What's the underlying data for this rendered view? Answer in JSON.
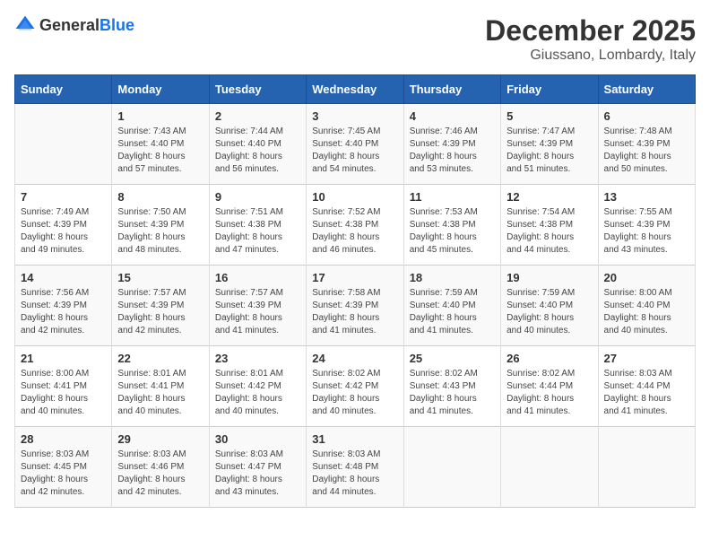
{
  "header": {
    "logo_general": "General",
    "logo_blue": "Blue",
    "month": "December 2025",
    "location": "Giussano, Lombardy, Italy"
  },
  "days_of_week": [
    "Sunday",
    "Monday",
    "Tuesday",
    "Wednesday",
    "Thursday",
    "Friday",
    "Saturday"
  ],
  "weeks": [
    [
      {
        "day": "",
        "info": ""
      },
      {
        "day": "1",
        "info": "Sunrise: 7:43 AM\nSunset: 4:40 PM\nDaylight: 8 hours\nand 57 minutes."
      },
      {
        "day": "2",
        "info": "Sunrise: 7:44 AM\nSunset: 4:40 PM\nDaylight: 8 hours\nand 56 minutes."
      },
      {
        "day": "3",
        "info": "Sunrise: 7:45 AM\nSunset: 4:40 PM\nDaylight: 8 hours\nand 54 minutes."
      },
      {
        "day": "4",
        "info": "Sunrise: 7:46 AM\nSunset: 4:39 PM\nDaylight: 8 hours\nand 53 minutes."
      },
      {
        "day": "5",
        "info": "Sunrise: 7:47 AM\nSunset: 4:39 PM\nDaylight: 8 hours\nand 51 minutes."
      },
      {
        "day": "6",
        "info": "Sunrise: 7:48 AM\nSunset: 4:39 PM\nDaylight: 8 hours\nand 50 minutes."
      }
    ],
    [
      {
        "day": "7",
        "info": "Sunrise: 7:49 AM\nSunset: 4:39 PM\nDaylight: 8 hours\nand 49 minutes."
      },
      {
        "day": "8",
        "info": "Sunrise: 7:50 AM\nSunset: 4:39 PM\nDaylight: 8 hours\nand 48 minutes."
      },
      {
        "day": "9",
        "info": "Sunrise: 7:51 AM\nSunset: 4:38 PM\nDaylight: 8 hours\nand 47 minutes."
      },
      {
        "day": "10",
        "info": "Sunrise: 7:52 AM\nSunset: 4:38 PM\nDaylight: 8 hours\nand 46 minutes."
      },
      {
        "day": "11",
        "info": "Sunrise: 7:53 AM\nSunset: 4:38 PM\nDaylight: 8 hours\nand 45 minutes."
      },
      {
        "day": "12",
        "info": "Sunrise: 7:54 AM\nSunset: 4:38 PM\nDaylight: 8 hours\nand 44 minutes."
      },
      {
        "day": "13",
        "info": "Sunrise: 7:55 AM\nSunset: 4:39 PM\nDaylight: 8 hours\nand 43 minutes."
      }
    ],
    [
      {
        "day": "14",
        "info": "Sunrise: 7:56 AM\nSunset: 4:39 PM\nDaylight: 8 hours\nand 42 minutes."
      },
      {
        "day": "15",
        "info": "Sunrise: 7:57 AM\nSunset: 4:39 PM\nDaylight: 8 hours\nand 42 minutes."
      },
      {
        "day": "16",
        "info": "Sunrise: 7:57 AM\nSunset: 4:39 PM\nDaylight: 8 hours\nand 41 minutes."
      },
      {
        "day": "17",
        "info": "Sunrise: 7:58 AM\nSunset: 4:39 PM\nDaylight: 8 hours\nand 41 minutes."
      },
      {
        "day": "18",
        "info": "Sunrise: 7:59 AM\nSunset: 4:40 PM\nDaylight: 8 hours\nand 41 minutes."
      },
      {
        "day": "19",
        "info": "Sunrise: 7:59 AM\nSunset: 4:40 PM\nDaylight: 8 hours\nand 40 minutes."
      },
      {
        "day": "20",
        "info": "Sunrise: 8:00 AM\nSunset: 4:40 PM\nDaylight: 8 hours\nand 40 minutes."
      }
    ],
    [
      {
        "day": "21",
        "info": "Sunrise: 8:00 AM\nSunset: 4:41 PM\nDaylight: 8 hours\nand 40 minutes."
      },
      {
        "day": "22",
        "info": "Sunrise: 8:01 AM\nSunset: 4:41 PM\nDaylight: 8 hours\nand 40 minutes."
      },
      {
        "day": "23",
        "info": "Sunrise: 8:01 AM\nSunset: 4:42 PM\nDaylight: 8 hours\nand 40 minutes."
      },
      {
        "day": "24",
        "info": "Sunrise: 8:02 AM\nSunset: 4:42 PM\nDaylight: 8 hours\nand 40 minutes."
      },
      {
        "day": "25",
        "info": "Sunrise: 8:02 AM\nSunset: 4:43 PM\nDaylight: 8 hours\nand 41 minutes."
      },
      {
        "day": "26",
        "info": "Sunrise: 8:02 AM\nSunset: 4:44 PM\nDaylight: 8 hours\nand 41 minutes."
      },
      {
        "day": "27",
        "info": "Sunrise: 8:03 AM\nSunset: 4:44 PM\nDaylight: 8 hours\nand 41 minutes."
      }
    ],
    [
      {
        "day": "28",
        "info": "Sunrise: 8:03 AM\nSunset: 4:45 PM\nDaylight: 8 hours\nand 42 minutes."
      },
      {
        "day": "29",
        "info": "Sunrise: 8:03 AM\nSunset: 4:46 PM\nDaylight: 8 hours\nand 42 minutes."
      },
      {
        "day": "30",
        "info": "Sunrise: 8:03 AM\nSunset: 4:47 PM\nDaylight: 8 hours\nand 43 minutes."
      },
      {
        "day": "31",
        "info": "Sunrise: 8:03 AM\nSunset: 4:48 PM\nDaylight: 8 hours\nand 44 minutes."
      },
      {
        "day": "",
        "info": ""
      },
      {
        "day": "",
        "info": ""
      },
      {
        "day": "",
        "info": ""
      }
    ]
  ]
}
